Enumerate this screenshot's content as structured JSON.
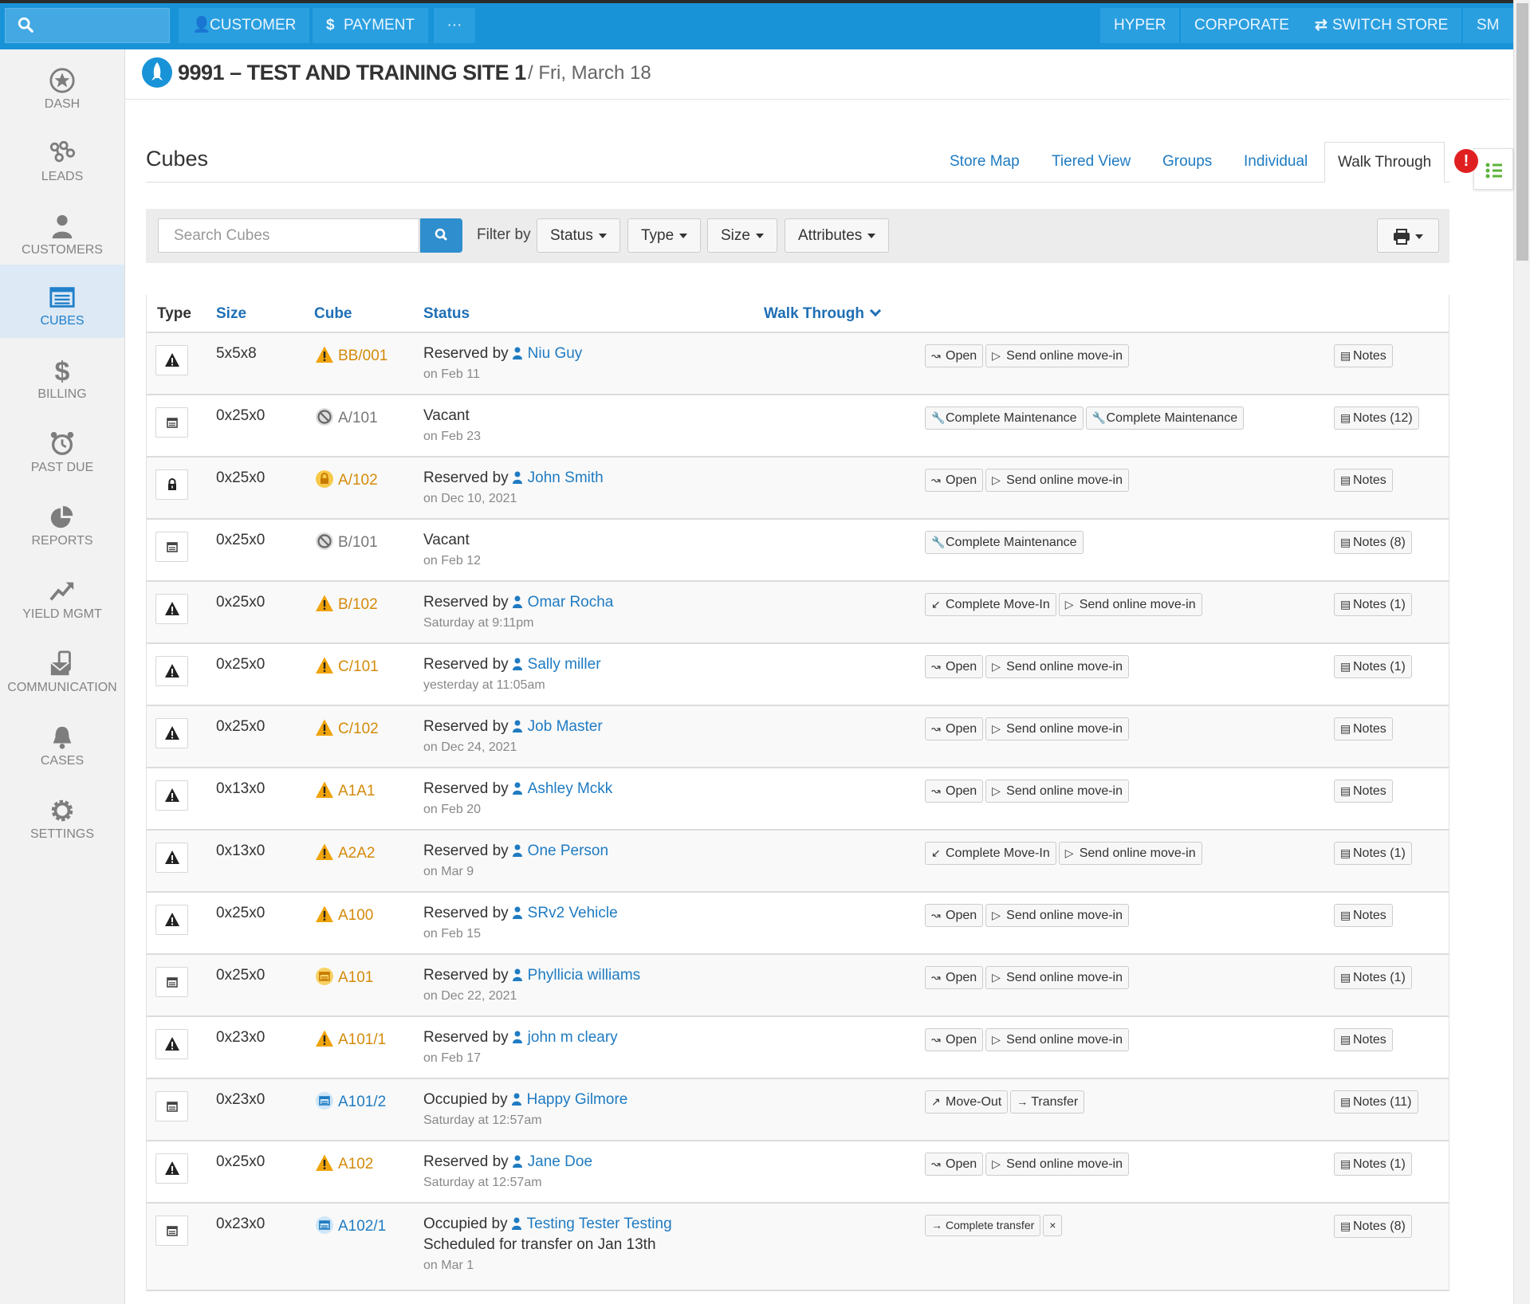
{
  "topbar": {
    "customer_label": "CUSTOMER",
    "payment_label": "PAYMENT",
    "more_label": "···",
    "hyper_label": "HYPER",
    "corporate_label": "CORPORATE",
    "switch_store_label": "SWITCH STORE",
    "user_initials": "SM"
  },
  "sidebar": {
    "items": [
      {
        "label": "DASH",
        "icon": "star-icon"
      },
      {
        "label": "LEADS",
        "icon": "leads-icon"
      },
      {
        "label": "CUSTOMERS",
        "icon": "user-icon"
      },
      {
        "label": "CUBES",
        "icon": "cubes-icon"
      },
      {
        "label": "BILLING",
        "icon": "dollar-icon"
      },
      {
        "label": "PAST DUE",
        "icon": "alarm-clock-icon"
      },
      {
        "label": "REPORTS",
        "icon": "pie-chart-icon"
      },
      {
        "label": "YIELD MGMT",
        "icon": "trend-up-icon"
      },
      {
        "label": "COMMUNICATION",
        "icon": "envelope-phone-icon"
      },
      {
        "label": "CASES",
        "icon": "bell-icon"
      },
      {
        "label": "SETTINGS",
        "icon": "gear-icon"
      }
    ],
    "active": "CUBES"
  },
  "header": {
    "site_name": "9991 – TEST AND TRAINING SITE 1",
    "date": "/ Fri, March 18"
  },
  "section": {
    "title": "Cubes",
    "tabs": [
      "Store Map",
      "Tiered View",
      "Groups",
      "Individual",
      "Walk Through"
    ],
    "active_tab": "Walk Through",
    "alert_badge": "!"
  },
  "filters": {
    "search_placeholder": "Search Cubes",
    "filter_by_label": "Filter by",
    "dropdowns": [
      "Status",
      "Type",
      "Size",
      "Attributes"
    ]
  },
  "table": {
    "columns": {
      "type": "Type",
      "size": "Size",
      "cube": "Cube",
      "status": "Status",
      "walk_through": "Walk Through"
    },
    "rows": [
      {
        "type_icon": "warning",
        "size": "5x5x8",
        "cube_icon": "warning",
        "cube": "BB/001",
        "status_prefix": "Reserved by",
        "customer": "Niu Guy",
        "sub": "on Feb 11",
        "actions": [
          {
            "g": "↝",
            "label": "Open"
          },
          {
            "g": "▷",
            "label": "Send online move-in"
          }
        ],
        "notes": "Notes"
      },
      {
        "type_icon": "storage",
        "size": "0x25x0",
        "cube_icon": "blocked",
        "cube": "A/101",
        "status_prefix": "Vacant",
        "customer": "",
        "sub": "on Feb 23",
        "actions": [
          {
            "g": "🔧",
            "label": "Complete Maintenance"
          },
          {
            "g": "🔧",
            "label": "Complete Maintenance"
          }
        ],
        "notes": "Notes (12)"
      },
      {
        "type_icon": "lock",
        "size": "0x25x0",
        "cube_icon": "lock",
        "cube": "A/102",
        "status_prefix": "Reserved by",
        "customer": "John Smith",
        "sub": "on Dec 10, 2021",
        "actions": [
          {
            "g": "↝",
            "label": "Open"
          },
          {
            "g": "▷",
            "label": "Send online move-in"
          }
        ],
        "notes": "Notes"
      },
      {
        "type_icon": "storage",
        "size": "0x25x0",
        "cube_icon": "blocked",
        "cube": "B/101",
        "status_prefix": "Vacant",
        "customer": "",
        "sub": "on Feb 12",
        "actions": [
          {
            "g": "🔧",
            "label": "Complete Maintenance"
          }
        ],
        "notes": "Notes (8)"
      },
      {
        "type_icon": "warning",
        "size": "0x25x0",
        "cube_icon": "warning",
        "cube": "B/102",
        "status_prefix": "Reserved by",
        "customer": "Omar Rocha",
        "sub": "Saturday at 9:11pm",
        "actions": [
          {
            "g": "↙",
            "label": "Complete Move-In"
          },
          {
            "g": "▷",
            "label": "Send online move-in"
          }
        ],
        "notes": "Notes (1)"
      },
      {
        "type_icon": "warning",
        "size": "0x25x0",
        "cube_icon": "warning",
        "cube": "C/101",
        "status_prefix": "Reserved by",
        "customer": "Sally miller",
        "sub": "yesterday at 11:05am",
        "actions": [
          {
            "g": "↝",
            "label": "Open"
          },
          {
            "g": "▷",
            "label": "Send online move-in"
          }
        ],
        "notes": "Notes (1)"
      },
      {
        "type_icon": "warning",
        "size": "0x25x0",
        "cube_icon": "warning",
        "cube": "C/102",
        "status_prefix": "Reserved by",
        "customer": "Job Master",
        "sub": "on Dec 24, 2021",
        "actions": [
          {
            "g": "↝",
            "label": "Open"
          },
          {
            "g": "▷",
            "label": "Send online move-in"
          }
        ],
        "notes": "Notes"
      },
      {
        "type_icon": "warning",
        "size": "0x13x0",
        "cube_icon": "warning",
        "cube": "A1A1",
        "status_prefix": "Reserved by",
        "customer": "Ashley Mckk",
        "sub": "on Feb 20",
        "actions": [
          {
            "g": "↝",
            "label": "Open"
          },
          {
            "g": "▷",
            "label": "Send online move-in"
          }
        ],
        "notes": "Notes"
      },
      {
        "type_icon": "warning",
        "size": "0x13x0",
        "cube_icon": "warning",
        "cube": "A2A2",
        "status_prefix": "Reserved by",
        "customer": "One Person",
        "sub": "on Mar 9",
        "actions": [
          {
            "g": "↙",
            "label": "Complete Move-In"
          },
          {
            "g": "▷",
            "label": "Send online move-in"
          }
        ],
        "notes": "Notes (1)"
      },
      {
        "type_icon": "warning",
        "size": "0x25x0",
        "cube_icon": "warning",
        "cube": "A100",
        "status_prefix": "Reserved by",
        "customer": "SRv2 Vehicle",
        "sub": "on Feb 15",
        "actions": [
          {
            "g": "↝",
            "label": "Open"
          },
          {
            "g": "▷",
            "label": "Send online move-in"
          }
        ],
        "notes": "Notes"
      },
      {
        "type_icon": "storage",
        "size": "0x25x0",
        "cube_icon": "storage-warn",
        "cube": "A101",
        "status_prefix": "Reserved by",
        "customer": "Phyllicia williams",
        "sub": "on Dec 22, 2021",
        "actions": [
          {
            "g": "↝",
            "label": "Open"
          },
          {
            "g": "▷",
            "label": "Send online move-in"
          }
        ],
        "notes": "Notes (1)"
      },
      {
        "type_icon": "warning",
        "size": "0x23x0",
        "cube_icon": "warning",
        "cube": "A101/1",
        "status_prefix": "Reserved by",
        "customer": "john m cleary",
        "sub": "on Feb 17",
        "actions": [
          {
            "g": "↝",
            "label": "Open"
          },
          {
            "g": "▷",
            "label": "Send online move-in"
          }
        ],
        "notes": "Notes"
      },
      {
        "type_icon": "storage",
        "size": "0x23x0",
        "cube_icon": "storage-blue",
        "cube": "A101/2",
        "status_prefix": "Occupied by",
        "customer": "Happy Gilmore",
        "sub": "Saturday at 12:57am",
        "actions": [
          {
            "g": "↗",
            "label": "Move-Out"
          },
          {
            "g": "→",
            "label": "Transfer"
          }
        ],
        "notes": "Notes (11)"
      },
      {
        "type_icon": "warning",
        "size": "0x25x0",
        "cube_icon": "warning",
        "cube": "A102",
        "status_prefix": "Reserved by",
        "customer": "Jane Doe",
        "sub": "Saturday at 12:57am",
        "actions": [
          {
            "g": "↝",
            "label": "Open"
          },
          {
            "g": "▷",
            "label": "Send online move-in"
          }
        ],
        "notes": "Notes (1)"
      },
      {
        "type_icon": "storage",
        "size": "0x23x0",
        "cube_icon": "storage-blue",
        "cube": "A102/1",
        "status_prefix": "Occupied by",
        "customer": "Testing Tester Testing",
        "extra": "Scheduled for transfer on Jan 13th",
        "sub": "on Mar 1",
        "actions": [
          {
            "g": "→",
            "label": "Complete transfer",
            "small": true
          },
          {
            "g": "",
            "label": "×",
            "small": true
          }
        ],
        "notes": "Notes (8)"
      }
    ]
  },
  "colors": {
    "topbar": "#1893d8",
    "link": "#1f7bc2",
    "warning": "#f0a30a",
    "alert": "#e02020"
  }
}
